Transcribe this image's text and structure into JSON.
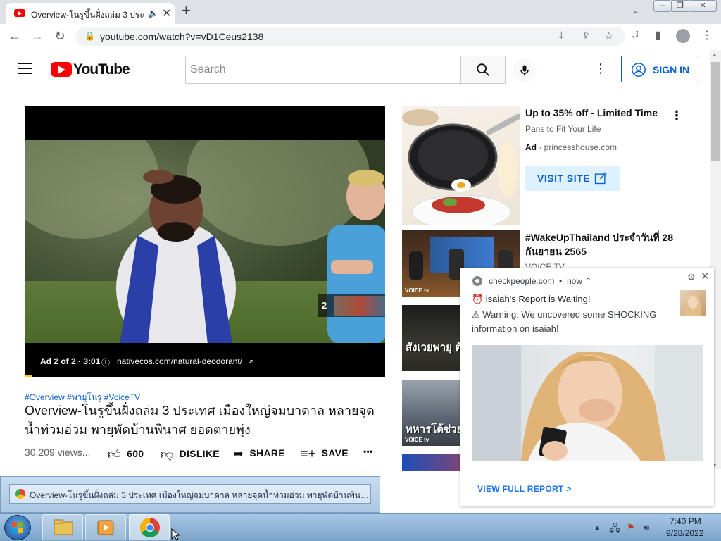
{
  "browser": {
    "tab_title": "Overview-โนรูขึ้นฝั่งถล่ม 3 ประเ",
    "tab_audio_icon": "speaker-icon",
    "tab_close": "✕",
    "new_tab": "+",
    "url": "youtube.com/watch?v=vD1Ceus2138"
  },
  "youtube": {
    "logo_text": "YouTube",
    "search_placeholder": "Search",
    "signin_label": "SIGN IN"
  },
  "player": {
    "skip_count": "2",
    "ad_info": "Ad 2 of 2 · 3:01",
    "ad_url": "nativecos.com/natural-deodorant/"
  },
  "video": {
    "hashtags": "#Overview #พายุโนรู #VoiceTV",
    "title": "Overview-โนรูขึ้นฝั่งถล่ม 3 ประเทศ เมืองใหญ่จมบาดาล หลายจุดน้ำท่วมอ่วม พายุพัดบ้านพินาศ ยอดตายพุ่ง",
    "views": "30,209 views...",
    "like_count": "600",
    "dislike_label": "DISLIKE",
    "share_label": "SHARE",
    "save_label": "SAVE",
    "more": "•••"
  },
  "sidebar_ad": {
    "title": "Up to 35% off - Limited Time",
    "subtitle": "Pans to Fit Your Life",
    "ad_badge": "Ad",
    "domain": "princesshouse.com",
    "visit_label": "VISIT SITE"
  },
  "recommendations": [
    {
      "title": "#WakeUpThailand ประจำวันที่ 28 กันยายน 2565",
      "channel": "VOICE TV",
      "brand": "VOICE tv"
    },
    {
      "caption": "สังเวยพายุ ต้นไม้โค่นท",
      "brand": ""
    },
    {
      "caption": "ทหารโต้ช่วย",
      "brand": "VOICE tv"
    }
  ],
  "notification": {
    "source": "checkpeople.com",
    "time": "now",
    "title": "⏰ isaiah's Report is Waiting!",
    "body": "⚠ Warning: We uncovered some SHOCKING information on isaiah!",
    "action": "VIEW FULL REPORT >"
  },
  "taskbar": {
    "preview_title": "Overview-โนรูขึ้นฝั่งถล่ม 3 ประเทศ เมืองใหญ่จมบาดาล หลายจุดน้ำท่วมอ่วม พายุพัดบ้านพินาศ ยอดตาย...",
    "time": "7:40 PM",
    "date": "9/28/2022"
  }
}
